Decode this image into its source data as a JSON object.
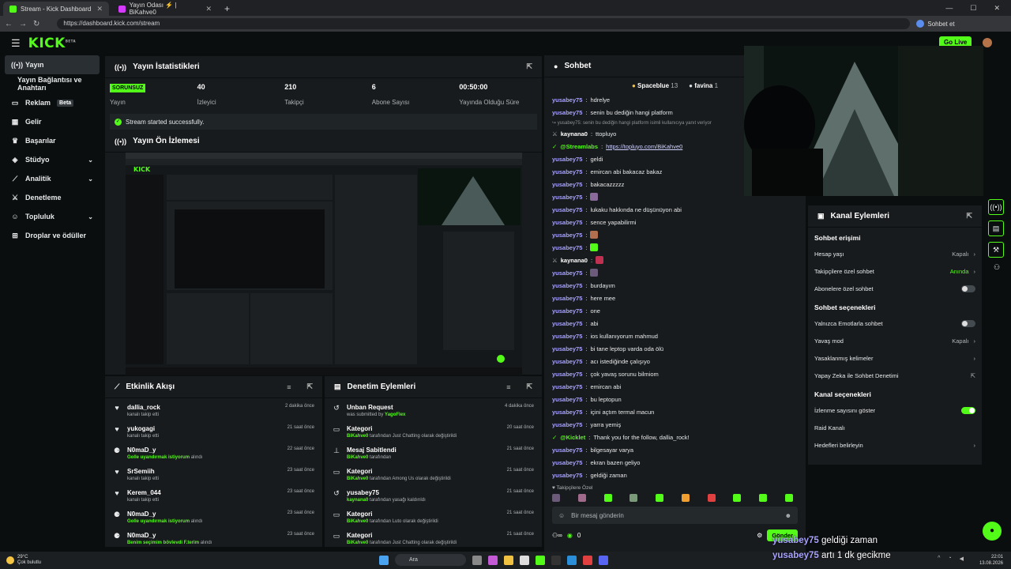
{
  "browser": {
    "tabs": [
      {
        "title": "Stream - Kick Dashboard",
        "color": "#53fc18"
      },
      {
        "title": "Yayın Odası ⚡ | BiKahve0",
        "color": "#d63aff"
      }
    ],
    "url": "https://dashboard.kick.com/stream",
    "profile_label": "Sohbet et"
  },
  "app": {
    "logo": "KICK",
    "logo_sup": "BETA",
    "go_live": "Go Live"
  },
  "sidebar": {
    "items": [
      {
        "label": "Yayın",
        "icon": "broadcast-icon"
      },
      {
        "label": "Yayın Bağlantısı ve Anahtarı",
        "icon": ""
      },
      {
        "label": "Reklam",
        "icon": "ad-icon",
        "badge": "Beta"
      },
      {
        "label": "Gelir",
        "icon": "revenue-icon"
      },
      {
        "label": "Başarılar",
        "icon": "trophy-icon"
      },
      {
        "label": "Stüdyo",
        "icon": "studio-icon"
      },
      {
        "label": "Analitik",
        "icon": "analytics-icon"
      },
      {
        "label": "Denetleme",
        "icon": "moderation-icon"
      },
      {
        "label": "Topluluk",
        "icon": "community-icon"
      },
      {
        "label": "Droplar ve ödüller",
        "icon": "drops-icon"
      }
    ]
  },
  "stats": {
    "title": "Yayın İstatistikleri",
    "items": [
      {
        "value": "SORUNSUZ",
        "label": "Yayın"
      },
      {
        "value": "40",
        "label": "İzleyici"
      },
      {
        "value": "210",
        "label": "Takipçi"
      },
      {
        "value": "6",
        "label": "Abone Sayısı"
      },
      {
        "value": "00:50:00",
        "label": "Yayında Olduğu Süre"
      }
    ],
    "success": "Stream started successfully."
  },
  "preview": {
    "title": "Yayın Ön İzlemesi"
  },
  "activity": {
    "title": "Etkinlik Akışı",
    "rows": [
      {
        "name": "dallia_rock",
        "desc": "kanalı takip etti",
        "highlight": "",
        "rest": "",
        "time": "2 dakika önce",
        "icon": "heart-icon"
      },
      {
        "name": "yukogagi",
        "desc": "kanalı takip etti",
        "highlight": "",
        "rest": "",
        "time": "21 saat önce",
        "icon": "heart-icon"
      },
      {
        "name": "N0maD_y",
        "desc": "",
        "highlight": "Golle uyandırmak istiyorum",
        "rest": " alındı",
        "time": "22 saat önce",
        "icon": "reward-icon"
      },
      {
        "name": "SrSemiih",
        "desc": "kanalı takip etti",
        "highlight": "",
        "rest": "",
        "time": "23 saat önce",
        "icon": "heart-icon"
      },
      {
        "name": "Kerem_044",
        "desc": "kanalı takip etti",
        "highlight": "",
        "rest": "",
        "time": "23 saat önce",
        "icon": "heart-icon"
      },
      {
        "name": "N0maD_y",
        "desc": "",
        "highlight": "Golle uyandırmak istiyorum",
        "rest": " alındı",
        "time": "23 saat önce",
        "icon": "reward-icon"
      },
      {
        "name": "N0maD_y",
        "desc": "",
        "highlight": "Benim seçimim bövlevdi F.terim",
        "rest": " alındı",
        "time": "23 saat önce",
        "icon": "reward-icon"
      }
    ]
  },
  "modlog": {
    "title": "Denetim Eylemleri",
    "rows": [
      {
        "name": "Unban Request",
        "pre": "was submitted by ",
        "highlight": "YagoFlex",
        "rest": "",
        "time": "4 dakika önce",
        "icon": "undo-icon"
      },
      {
        "name": "Kategori",
        "pre": "",
        "highlight": "BiKahve0",
        "rest": " tarafından Just Chatting olarak değiştirildi",
        "time": "20 saat önce",
        "icon": "category-icon"
      },
      {
        "name": "Mesaj Sabitlendi",
        "pre": "",
        "highlight": "BiKahve0",
        "rest": " tarafından",
        "time": "21 saat önce",
        "icon": "pin-icon"
      },
      {
        "name": "Kategori",
        "pre": "",
        "highlight": "BiKahve0",
        "rest": " tarafından Among Us olarak değiştirildi",
        "time": "21 saat önce",
        "icon": "category-icon"
      },
      {
        "name": "yusabey75",
        "pre": "",
        "highlight": "kaynana0",
        "rest": " tarafından yasağı kaldırıldı",
        "time": "21 saat önce",
        "icon": "undo-icon"
      },
      {
        "name": "Kategori",
        "pre": "",
        "highlight": "BiKahve0",
        "rest": " tarafından Luto olarak değiştirildi",
        "time": "21 saat önce",
        "icon": "category-icon"
      },
      {
        "name": "Kategori",
        "pre": "",
        "highlight": "BiKahve0",
        "rest": " tarafından Just Chatting olarak değiştirildi",
        "time": "21 saat önce",
        "icon": "category-icon"
      }
    ]
  },
  "chat": {
    "title": "Sohbet",
    "leaders": [
      {
        "name": "Spaceblue",
        "count": "13"
      },
      {
        "name": "favina",
        "count": "1"
      }
    ],
    "messages": [
      {
        "user": "yusabey75",
        "text": "hdrelye",
        "cls": ""
      },
      {
        "user": "yusabey75",
        "text": "senin bu dediğin hangi platform",
        "cls": ""
      },
      {
        "user": "",
        "text": "↪ yusabey75: senin bu dediğin hangi platform isimli kullanıcıya yanıt veriyor",
        "cls": "reply"
      },
      {
        "user": "kaynana0",
        "text": "ttopluyo",
        "cls": "w"
      },
      {
        "user": "@Streamlabs",
        "text": "https://topluyo.com/BiKahve0",
        "cls": "g",
        "link": true
      },
      {
        "user": "yusabey75",
        "text": "geldi",
        "cls": ""
      },
      {
        "user": "yusabey75",
        "text": "emircan abi bakacaz bakaz",
        "cls": ""
      },
      {
        "user": "yusabey75",
        "text": "bakacazzzzz",
        "cls": ""
      },
      {
        "user": "yusabey75",
        "text": "",
        "cls": "",
        "emote": true
      },
      {
        "user": "yusabey75",
        "text": "lukaku hakkında ne düşünüyon abi",
        "cls": ""
      },
      {
        "user": "yusabey75",
        "text": "sence yapabilirmi",
        "cls": ""
      },
      {
        "user": "yusabey75",
        "text": "",
        "cls": "",
        "emote": true
      },
      {
        "user": "yusabey75",
        "text": "",
        "cls": "",
        "emote": true
      },
      {
        "user": "kaynana0",
        "text": "",
        "cls": "w",
        "emote": true
      },
      {
        "user": "yusabey75",
        "text": "",
        "cls": "",
        "emote": true
      },
      {
        "user": "yusabey75",
        "text": "burdayım",
        "cls": ""
      },
      {
        "user": "yusabey75",
        "text": "here mee",
        "cls": ""
      },
      {
        "user": "yusabey75",
        "text": "one",
        "cls": ""
      },
      {
        "user": "yusabey75",
        "text": "abi",
        "cls": ""
      },
      {
        "user": "yusabey75",
        "text": "ios kullanıyorum mahmud",
        "cls": ""
      },
      {
        "user": "yusabey75",
        "text": "bi tane leptop varda oda ölü",
        "cls": ""
      },
      {
        "user": "yusabey75",
        "text": "acı istediğinde çalışıyo",
        "cls": ""
      },
      {
        "user": "yusabey75",
        "text": "çok yavaş sorunu bilmiom",
        "cls": ""
      },
      {
        "user": "yusabey75",
        "text": "emircan abi",
        "cls": ""
      },
      {
        "user": "yusabey75",
        "text": "bu leptopun",
        "cls": ""
      },
      {
        "user": "yusabey75",
        "text": "içini açtım termal macun",
        "cls": ""
      },
      {
        "user": "yusabey75",
        "text": "yarra yemiş",
        "cls": ""
      },
      {
        "user": "@Kicklet",
        "text": "Thank you for the follow, dallia_rock!",
        "cls": "g"
      },
      {
        "user": "yusabey75",
        "text": "bilgesayar varya",
        "cls": ""
      },
      {
        "user": "yusabey75",
        "text": "ekran bazen geliyo",
        "cls": ""
      },
      {
        "user": "yusabey75",
        "text": "geldiği zaman",
        "cls": ""
      },
      {
        "user": "yusabey75",
        "text": "artı 1 dk gecikme",
        "cls": ""
      }
    ],
    "followers_only": "♥ Takipçilere Özel",
    "input_placeholder": "Bir mesaj gönderin",
    "send": "Gönder",
    "points": "0"
  },
  "actions": {
    "title": "Kanal Eylemleri",
    "sections": [
      {
        "heading": "Sohbet erişimi",
        "rows": [
          {
            "label": "Hesap yaşı",
            "value": "Kapalı",
            "type": "chev"
          },
          {
            "label": "Takipçilere özel sohbet",
            "value": "Anında",
            "type": "chev-green"
          },
          {
            "label": "Abonelere özel sohbet",
            "value": "",
            "type": "toggle-off"
          }
        ]
      },
      {
        "heading": "Sohbet seçenekleri",
        "rows": [
          {
            "label": "Yalnızca Emotlarla sohbet",
            "value": "",
            "type": "toggle-off"
          },
          {
            "label": "Yavaş mod",
            "value": "Kapalı",
            "type": "chev"
          },
          {
            "label": "Yasaklanmış kelimeler",
            "value": "",
            "type": "chev"
          },
          {
            "label": "Yapay Zeka ile Sohbet Denetimi",
            "value": "",
            "type": "ext"
          }
        ]
      },
      {
        "heading": "Kanal seçenekleri",
        "rows": [
          {
            "label": "İzlenme sayısını göster",
            "value": "",
            "type": "toggle-on"
          },
          {
            "label": "Raid Kanalı",
            "value": "",
            "type": "none"
          },
          {
            "label": "Hedefleri belirleyin",
            "value": "",
            "type": "chev"
          }
        ]
      }
    ]
  },
  "overlay": [
    {
      "user": "yusabey75",
      "text": "geldiği zaman"
    },
    {
      "user": "yusabey75",
      "text": "artı 1 dk gecikme"
    }
  ],
  "taskbar": {
    "temp": "29°C",
    "weather": "Çok bulutlu",
    "search": "Ara",
    "time": "22:01",
    "date": "13.08.2026"
  },
  "colors": {
    "accent": "#53fc18",
    "username": "#a8a2ff",
    "panel": "#181b1d",
    "bg": "#0b0e0f"
  }
}
